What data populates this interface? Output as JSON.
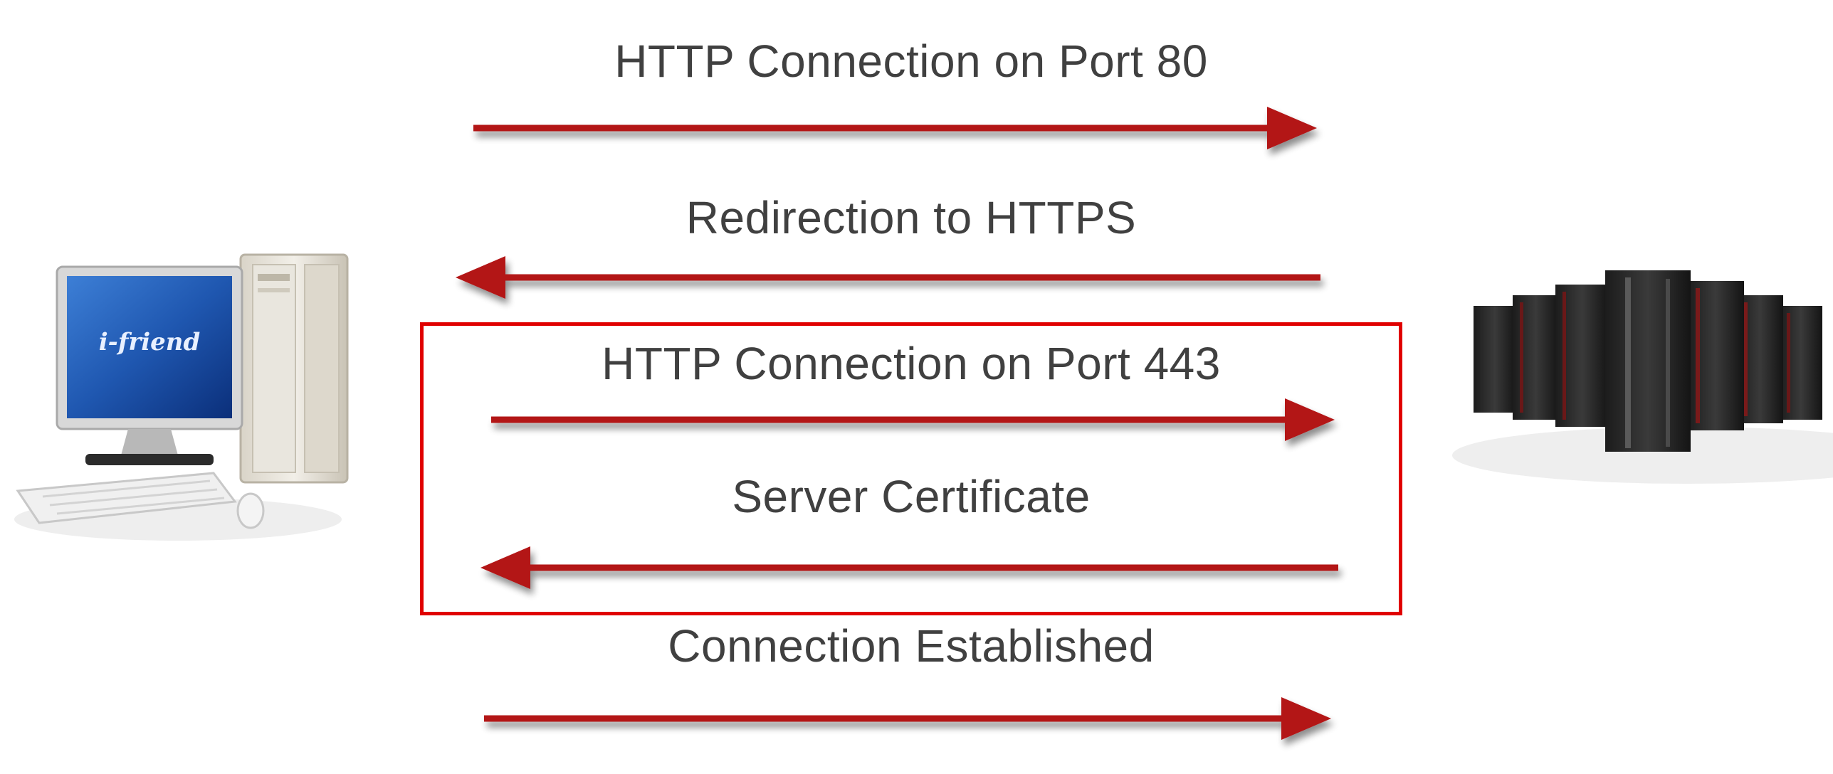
{
  "messages": [
    {
      "label": "HTTP Connection on Port 80",
      "direction": "client-to-server"
    },
    {
      "label": "Redirection to HTTPS",
      "direction": "server-to-client"
    },
    {
      "label": "HTTP Connection on Port 443",
      "direction": "client-to-server"
    },
    {
      "label": "Server Certificate",
      "direction": "server-to-client"
    },
    {
      "label": "Connection Established",
      "direction": "client-to-server"
    }
  ],
  "client": {
    "screen_brand": "i-friend"
  },
  "colors": {
    "arrow": "#b31217",
    "highlight": "#e00000",
    "text": "#404040"
  }
}
